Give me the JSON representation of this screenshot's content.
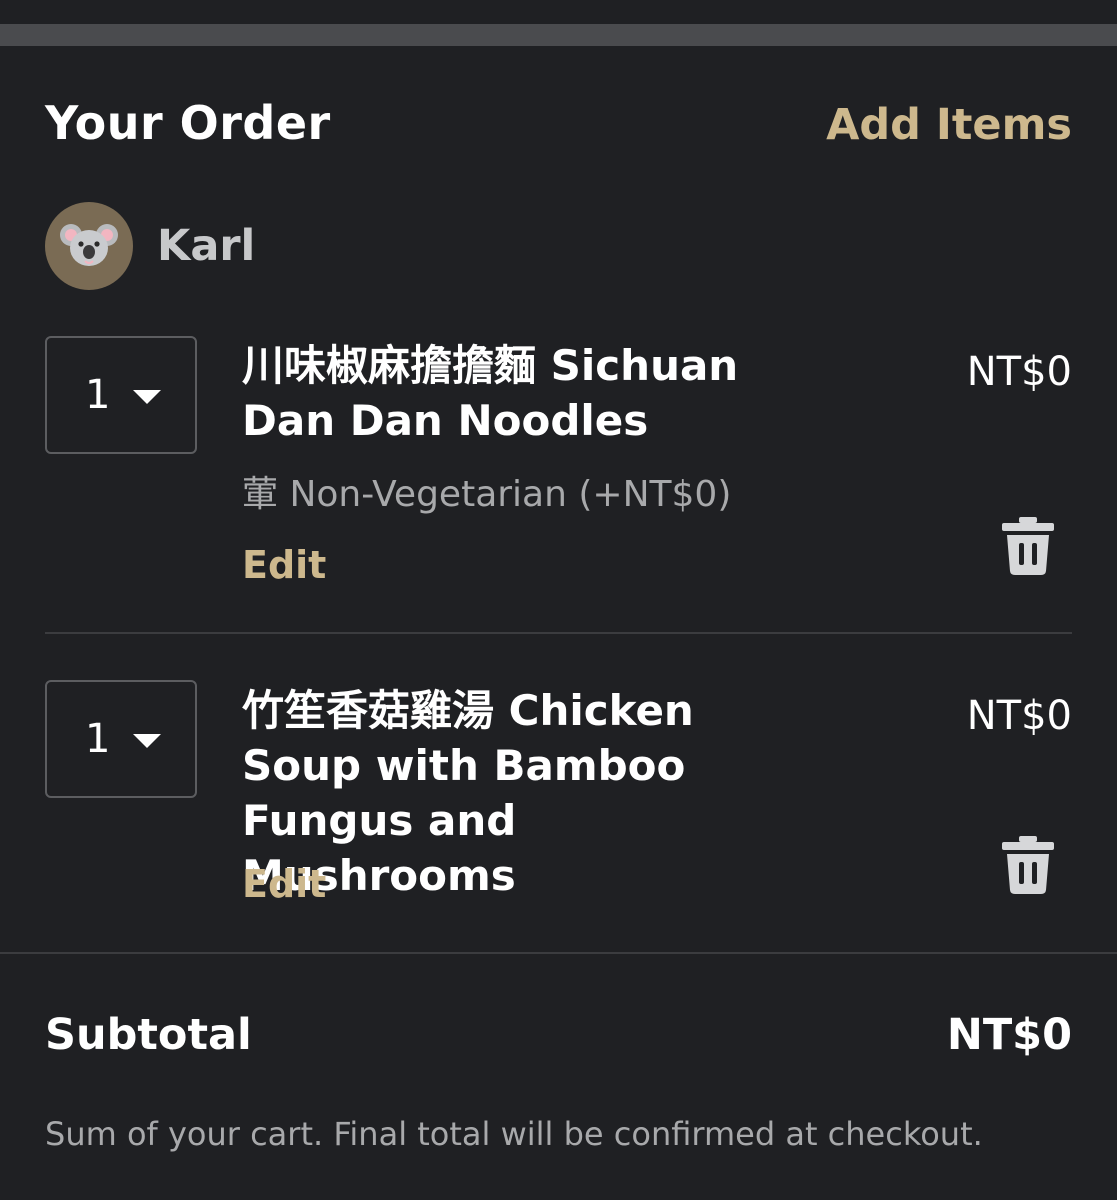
{
  "header": {
    "title": "Your Order",
    "add_items_label": "Add Items"
  },
  "user": {
    "name": "Karl",
    "avatar_icon": "koala-icon"
  },
  "items": [
    {
      "quantity": "1",
      "name": "川味椒麻擔擔麵 Sichuan Dan Dan Noodles",
      "option": "葷 Non-Vegetarian (+NT$0)",
      "edit_label": "Edit",
      "price": "NT$0"
    },
    {
      "quantity": "1",
      "name": "竹笙香菇雞湯 Chicken Soup with Bamboo Fungus and Mushrooms",
      "edit_label": "Edit",
      "price": "NT$0"
    }
  ],
  "summary": {
    "subtotal_label": "Subtotal",
    "subtotal_value": "NT$0",
    "footnote": "Sum of your cart. Final total will be confirmed at checkout."
  },
  "colors": {
    "background": "#1f2023",
    "accent": "#cdb88d",
    "muted_text": "#a8a9ab",
    "divider": "#3b3c3f"
  }
}
